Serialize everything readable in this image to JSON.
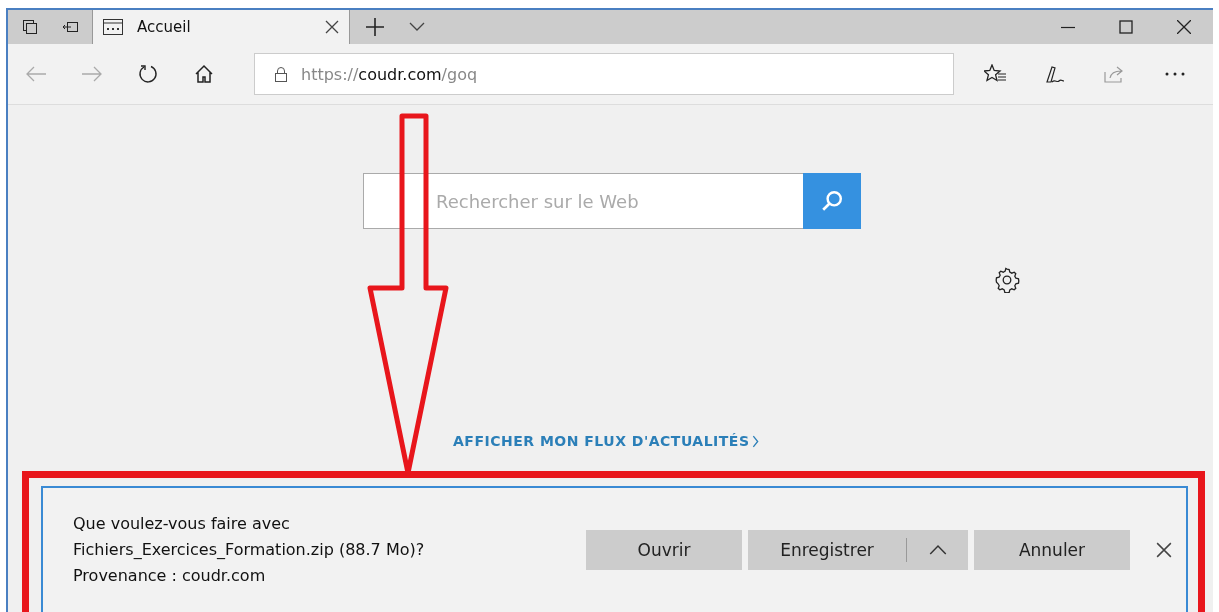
{
  "tab": {
    "title": "Accueil",
    "selected": true
  },
  "address": {
    "scheme": "https://",
    "host": "coudr.com",
    "path": "/goq"
  },
  "search": {
    "placeholder": "Rechercher sur le Web"
  },
  "news_link": "AFFICHER MON FLUX D'ACTUALITÉS",
  "download": {
    "lines": [
      "Que voulez-vous faire avec",
      "Fichiers_Exercices_Formation.zip (88.7 Mo)?",
      "Provenance : coudr.com"
    ],
    "buttons": [
      {
        "label": "Ouvrir",
        "kind": "plain"
      },
      {
        "label": "Enregistrer",
        "kind": "split"
      },
      {
        "label": "Annuler",
        "kind": "plain"
      }
    ]
  }
}
